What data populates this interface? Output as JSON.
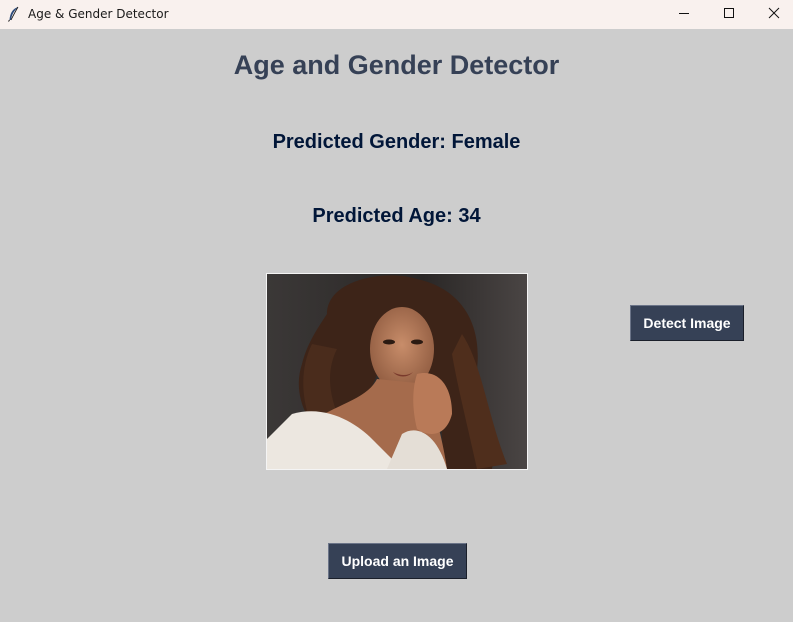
{
  "window": {
    "title": "Age & Gender Detector",
    "app_icon": "feather-icon",
    "controls": {
      "minimize_icon": "minimize-icon",
      "maximize_icon": "maximize-icon",
      "close_icon": "close-icon"
    }
  },
  "main": {
    "heading": "Age and Gender Detector",
    "predicted_gender": "Predicted Gender: Female",
    "predicted_age": "Predicted Age: 34"
  },
  "buttons": {
    "detect_label": "Detect Image",
    "upload_label": "Upload an Image"
  },
  "colors": {
    "background": "#cdcdcd",
    "titlebar": "#f9f1ee",
    "heading": "#364156",
    "prediction_text": "#011638",
    "button_bg": "#364156",
    "button_text": "#ffffff"
  }
}
